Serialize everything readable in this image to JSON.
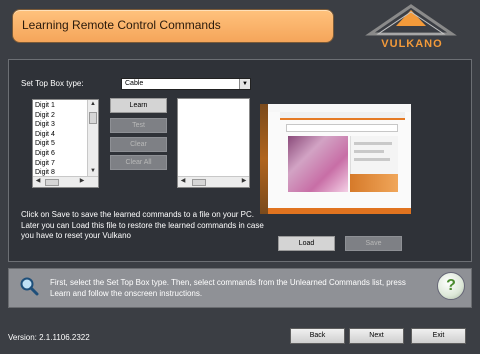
{
  "header": {
    "title": "Learning Remote Control Commands",
    "logo_text": "VULKANO"
  },
  "stb": {
    "label": "Set Top Box type:",
    "selected": "Cable"
  },
  "unlearned_list": {
    "items": [
      "Digit 1",
      "Digit 2",
      "Digit 3",
      "Digit 4",
      "Digit 5",
      "Digit 6",
      "Digit 7",
      "Digit 8"
    ]
  },
  "buttons": {
    "learn": "Learn",
    "test": "Test",
    "clear": "Clear",
    "clear_all": "Clear All",
    "load": "Load",
    "save": "Save"
  },
  "description": "Click on Save to save the learned commands to a file on your PC. Later you can Load this file to restore the learned commands in case you have to reset your Vulkano",
  "info": {
    "text": "First, select the Set Top Box type. Then, select commands from the Unlearned Commands list, press Learn and follow the onscreen instructions.",
    "help_glyph": "?"
  },
  "footer": {
    "version": "Version: 2.1.1106.2322",
    "back": "Back",
    "next": "Next",
    "exit": "Exit"
  },
  "colors": {
    "accent": "#f5a55a",
    "background": "#3b3e44",
    "info_bar": "#8f9196"
  }
}
